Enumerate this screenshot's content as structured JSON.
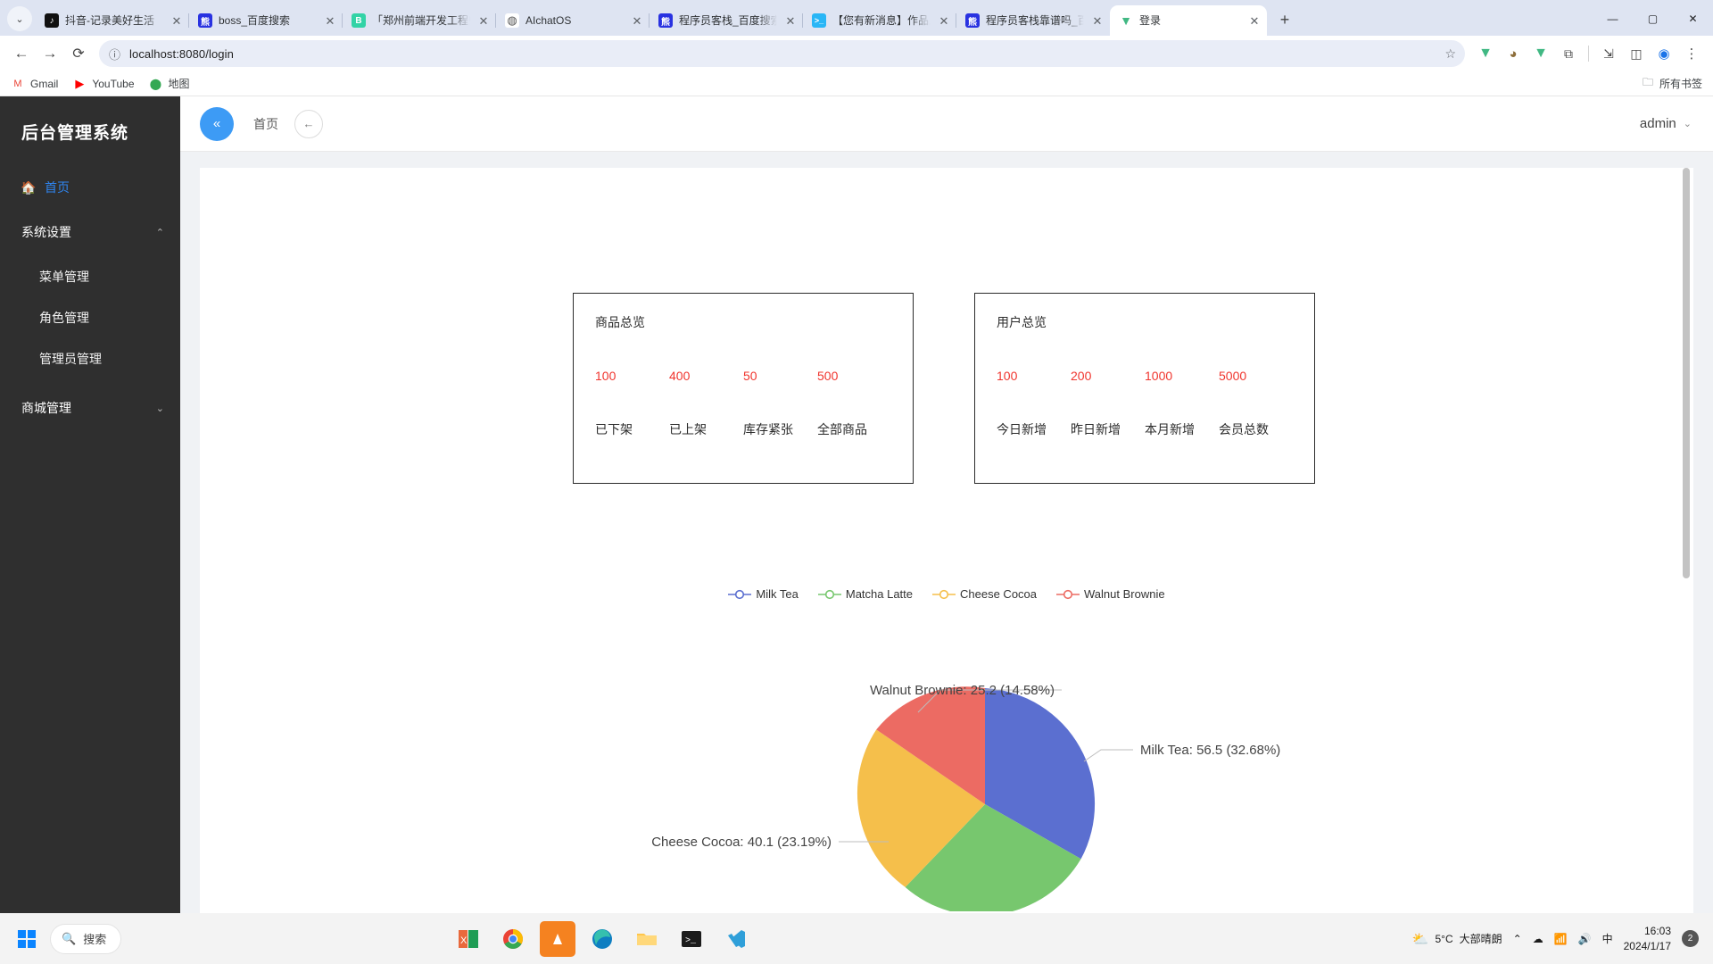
{
  "browser": {
    "tabs": [
      {
        "title": "抖音-记录美好生活",
        "icon": "tiktok-icon",
        "active": false
      },
      {
        "title": "boss_百度搜索",
        "icon": "baidu-icon",
        "active": false
      },
      {
        "title": "「郑州前端开发工程师招聘",
        "icon": "boss-icon",
        "active": false
      },
      {
        "title": "AIchatOS",
        "icon": "aichatos-icon",
        "active": false
      },
      {
        "title": "程序员客栈_百度搜索",
        "icon": "baidu-icon",
        "active": false
      },
      {
        "title": "【您有新消息】作品上传",
        "icon": "terminal-icon",
        "active": false
      },
      {
        "title": "程序员客栈靠谱吗_百度搜",
        "icon": "baidu-icon",
        "active": false
      },
      {
        "title": "登录",
        "icon": "vue-icon",
        "active": true
      }
    ],
    "tab_close_label": "✕",
    "new_tab_label": "+",
    "tablist_label": "⌄",
    "window_controls": {
      "minimize": "—",
      "maximize": "▢",
      "close": "✕"
    },
    "nav": {
      "back": "←",
      "forward": "→",
      "reload": "⟳"
    },
    "omnibox": {
      "info_icon": "ⓘ",
      "url": "localhost:8080/login",
      "star": "☆"
    },
    "toolbar_icons": [
      "vue-devtools-icon",
      "extension-cookie-icon",
      "vue-icon-2",
      "extensions-icon",
      "split-view-icon",
      "sidepanel-icon",
      "profile-icon",
      "menu-icon"
    ],
    "bookmarks": [
      {
        "label": "Gmail",
        "icon": "gmail-icon"
      },
      {
        "label": "YouTube",
        "icon": "youtube-icon"
      },
      {
        "label": "地图",
        "icon": "maps-icon"
      }
    ],
    "bookmarks_right": {
      "label": "所有书签",
      "icon": "folder-icon"
    }
  },
  "sidebar": {
    "brand": "后台管理系统",
    "home": {
      "label": "首页",
      "icon": "home-icon"
    },
    "groups": [
      {
        "label": "系统设置",
        "chevron": "⌃",
        "expanded": true,
        "items": [
          {
            "label": "菜单管理"
          },
          {
            "label": "角色管理"
          },
          {
            "label": "管理员管理"
          }
        ]
      },
      {
        "label": "商城管理",
        "chevron": "⌄",
        "expanded": false,
        "items": []
      }
    ]
  },
  "topbar": {
    "collapse_icon": "«",
    "breadcrumb": "首页",
    "back_icon": "←",
    "user": "admin",
    "user_chevron": "⌄"
  },
  "cards": [
    {
      "title": "商品总览",
      "stats": [
        {
          "value": "100",
          "label": "已下架"
        },
        {
          "value": "400",
          "label": "已上架"
        },
        {
          "value": "50",
          "label": "库存紧张"
        },
        {
          "value": "500",
          "label": "全部商品"
        }
      ]
    },
    {
      "title": "用户总览",
      "stats": [
        {
          "value": "100",
          "label": "今日新增"
        },
        {
          "value": "200",
          "label": "昨日新增"
        },
        {
          "value": "1000",
          "label": "本月新增"
        },
        {
          "value": "5000",
          "label": "会员总数"
        }
      ]
    }
  ],
  "chart_data": {
    "type": "pie",
    "title": "",
    "legend_position": "top-center",
    "labels": [
      "Milk Tea",
      "Matcha Latte",
      "Cheese Cocoa",
      "Walnut Brownie"
    ],
    "values": [
      56.5,
      51.0,
      40.1,
      25.2
    ],
    "percentages": [
      "32.68%",
      "29.55%",
      "23.19%",
      "14.58%"
    ],
    "colors": [
      "#5b6fd0",
      "#77c76e",
      "#f5bf4b",
      "#ec6b63"
    ],
    "annotations": [
      "Milk Tea: 56.5 (32.68%)",
      "Cheese Cocoa: 40.1 (23.19%)",
      "Walnut Brownie: 25.2 (14.58%)"
    ],
    "annotation_positions": [
      "right",
      "left",
      "upper-left"
    ]
  },
  "taskbar": {
    "start_icon": "windows-icon",
    "search_icon": "search-icon",
    "search_placeholder": "搜索",
    "apps": [
      "excel-icon",
      "chrome-icon",
      "vlc-icon",
      "edge-icon",
      "explorer-icon",
      "terminal-icon",
      "vscode-icon"
    ],
    "weather": {
      "icon": "partly-cloudy-icon",
      "temp": "5°C",
      "desc": "大部晴朗"
    },
    "tray": [
      "chevron-up-icon",
      "onedrive-icon",
      "network-icon",
      "volume-icon",
      "ime-icon"
    ],
    "ime_label": "中",
    "clock": {
      "time": "16:03",
      "date": "2024/1/17"
    },
    "notification_count": "2"
  }
}
